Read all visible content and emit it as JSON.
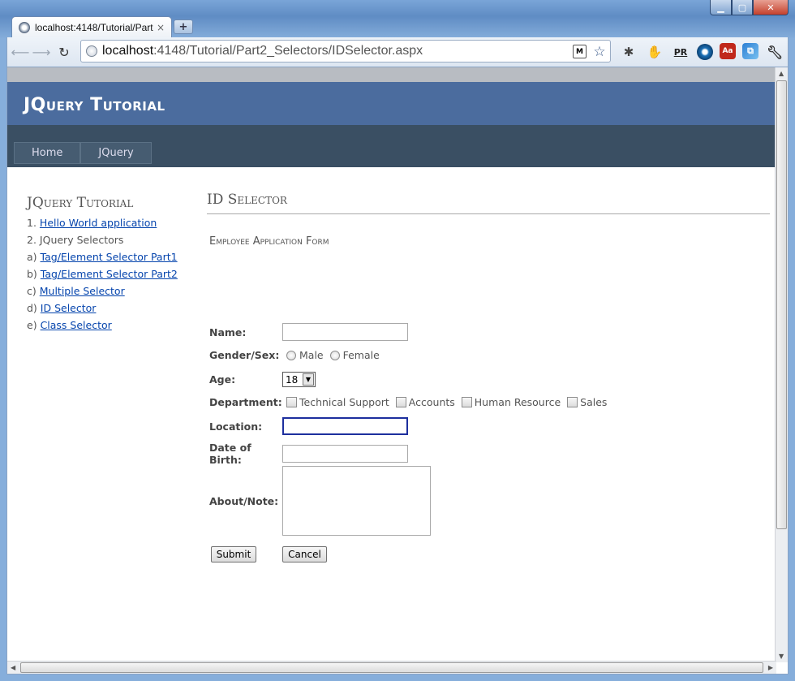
{
  "browser": {
    "tab_title": "localhost:4148/Tutorial/Part",
    "tab_close": "×",
    "new_tab": "+",
    "url_host": "localhost",
    "url_rest": ":4148/Tutorial/Part2_Selectors/IDSelector.aspx",
    "icons": {
      "back": "back-arrow-icon",
      "forward": "forward-arrow-icon",
      "reload": "reload-icon",
      "star": "star-icon",
      "wrench": "wrench-icon"
    },
    "ext_pr": "PR",
    "ext_acrobat": "Aa"
  },
  "site": {
    "title": "JQuery Tutorial",
    "menu": [
      "Home",
      "JQuery"
    ]
  },
  "sidebar": {
    "title": "JQuery Tutorial",
    "items": [
      {
        "prefix": "1.",
        "label": "Hello World application",
        "link": true
      },
      {
        "prefix": "2.",
        "label": "JQuery Selectors",
        "link": false
      },
      {
        "prefix": "a)",
        "label": "Tag/Element Selector Part1",
        "link": true
      },
      {
        "prefix": "b)",
        "label": "Tag/Element Selector Part2",
        "link": true
      },
      {
        "prefix": "c)",
        "label": "Multiple Selector",
        "link": true
      },
      {
        "prefix": "d)",
        "label": "ID Selector",
        "link": true
      },
      {
        "prefix": "e)",
        "label": "Class Selector",
        "link": true
      }
    ]
  },
  "main": {
    "heading": "ID Selector",
    "form_title": "Employee Application Form",
    "labels": {
      "name": "Name:",
      "gender": "Gender/Sex:",
      "age": "Age:",
      "department": "Department:",
      "location": "Location:",
      "dob": "Date of Birth:",
      "about": "About/Note:"
    },
    "gender_options": [
      "Male",
      "Female"
    ],
    "age_value": "18",
    "departments": [
      "Technical Support",
      "Accounts",
      "Human Resource",
      "Sales"
    ],
    "submit": "Submit",
    "cancel": "Cancel"
  }
}
